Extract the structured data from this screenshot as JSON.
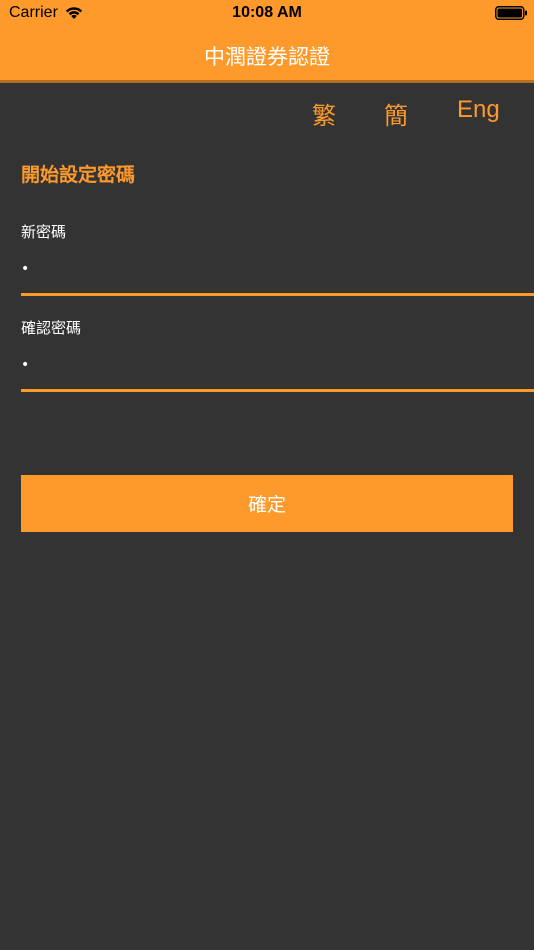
{
  "status_bar": {
    "carrier": "Carrier",
    "time": "10:08 AM"
  },
  "header": {
    "title": "中潤證券認證"
  },
  "language": {
    "traditional": "繁",
    "simplified": "簡",
    "english": "Eng"
  },
  "form": {
    "section_title": "開始設定密碼",
    "new_password": {
      "label": "新密碼",
      "value": "•"
    },
    "confirm_password": {
      "label": "確認密碼",
      "value": "•"
    },
    "submit_label": "確定"
  },
  "colors": {
    "accent": "#FE9A2C",
    "background": "#333333",
    "text": "#FFFFFF"
  },
  "icons": [
    "wifi-icon",
    "battery-icon"
  ]
}
